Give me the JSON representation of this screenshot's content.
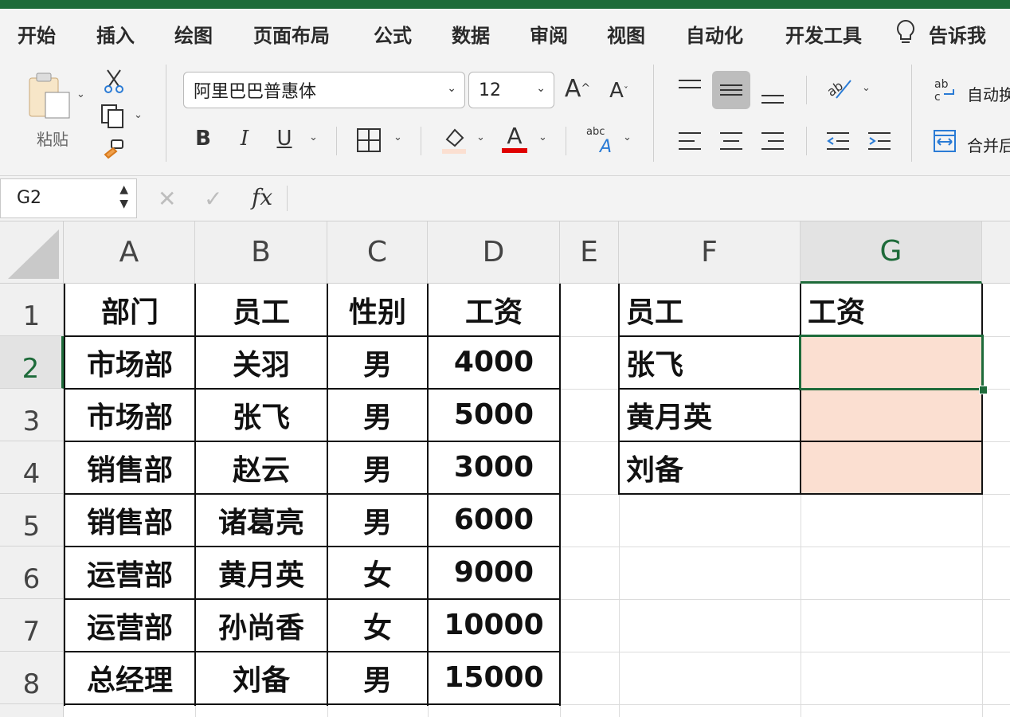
{
  "tabs": [
    "开始",
    "插入",
    "绘图",
    "页面布局",
    "公式",
    "数据",
    "审阅",
    "视图",
    "自动化",
    "开发工具",
    "告诉我"
  ],
  "ribbon": {
    "paste_label": "粘贴",
    "font_name": "阿里巴巴普惠体",
    "font_size": "12",
    "bold": "B",
    "italic": "I",
    "underline": "U",
    "font_color_glyph": "A",
    "wrap_text_label": "自动换",
    "merge_label": "合并后"
  },
  "formula_bar": {
    "name_box": "G2",
    "fx": "fx",
    "content": ""
  },
  "columns": [
    "A",
    "B",
    "C",
    "D",
    "E",
    "F",
    "G"
  ],
  "rows": [
    "1",
    "2",
    "3",
    "4",
    "5",
    "6",
    "7",
    "8"
  ],
  "table_left": {
    "headers": [
      "部门",
      "员工",
      "性别",
      "工资"
    ],
    "rows": [
      [
        "市场部",
        "关羽",
        "男",
        "4000"
      ],
      [
        "市场部",
        "张飞",
        "男",
        "5000"
      ],
      [
        "销售部",
        "赵云",
        "男",
        "3000"
      ],
      [
        "销售部",
        "诸葛亮",
        "男",
        "6000"
      ],
      [
        "运营部",
        "黄月英",
        "女",
        "9000"
      ],
      [
        "运营部",
        "孙尚香",
        "女",
        "10000"
      ],
      [
        "总经理",
        "刘备",
        "男",
        "15000"
      ]
    ]
  },
  "table_right": {
    "headers": [
      "员工",
      "工资"
    ],
    "rows": [
      [
        "张飞",
        ""
      ],
      [
        "黄月英",
        ""
      ],
      [
        "刘备",
        ""
      ]
    ]
  },
  "colors": {
    "accent": "#1e6b3a",
    "fill_highlight": "#fbdfd1",
    "font_color_red": "#e00000"
  }
}
